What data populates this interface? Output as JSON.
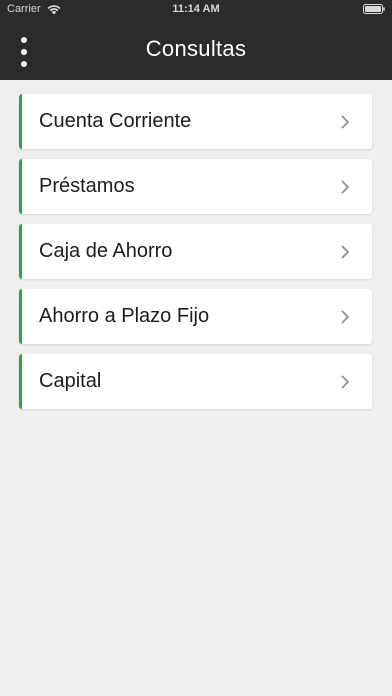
{
  "status_bar": {
    "carrier": "Carrier",
    "time": "11:14 AM",
    "wifi_icon": "wifi-icon",
    "battery_icon": "battery-icon"
  },
  "header": {
    "title": "Consultas",
    "menu_icon": "more-vertical-icon"
  },
  "colors": {
    "header_bg": "#2b2b2b",
    "accent": "#3f9a4f",
    "page_bg": "#efefef",
    "chevron": "#8e8e8e"
  },
  "menu": {
    "items": [
      {
        "label": "Cuenta Corriente",
        "icon": "chevron-right-icon"
      },
      {
        "label": "Préstamos",
        "icon": "chevron-right-icon"
      },
      {
        "label": "Caja de Ahorro",
        "icon": "chevron-right-icon"
      },
      {
        "label": "Ahorro a Plazo Fijo",
        "icon": "chevron-right-icon"
      },
      {
        "label": "Capital",
        "icon": "chevron-right-icon"
      }
    ]
  }
}
